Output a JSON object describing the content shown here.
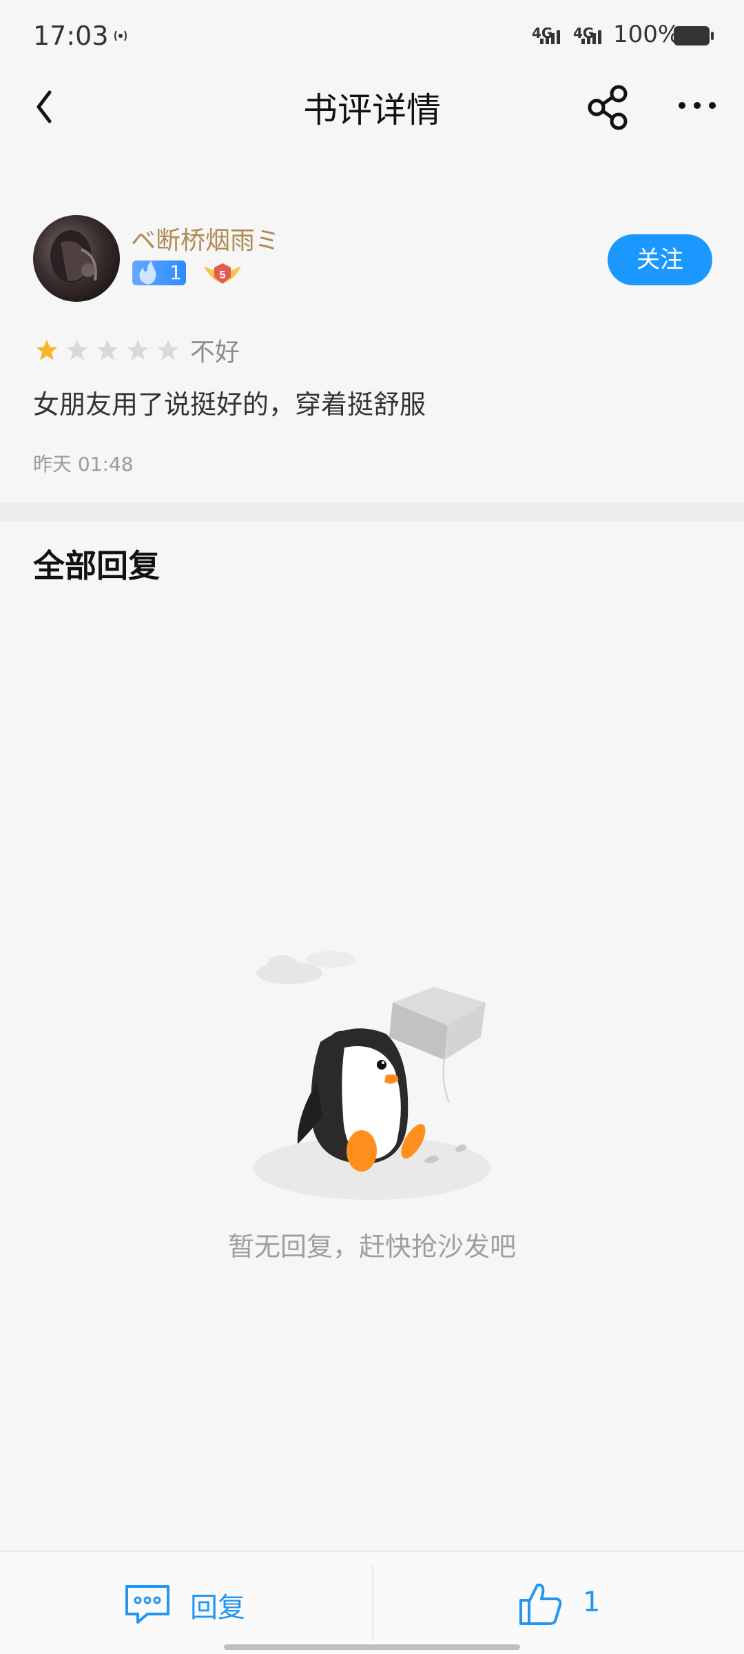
{
  "status_bar": {
    "time": "17:03",
    "network1": "4G",
    "network2": "4G",
    "battery": "100%"
  },
  "header": {
    "title": "书评详情",
    "back_icon": "chevron-left-icon",
    "share_icon": "share-icon",
    "more_icon": "more-dots-icon"
  },
  "review": {
    "username": "ベ断桥烟雨ミ",
    "fire_level": "1",
    "medal_level": "5",
    "follow_label": "关注",
    "rating": 1,
    "rating_max": 5,
    "rating_text": "不好",
    "content": "女朋友用了说挺好的，穿着挺舒服",
    "time": "昨天 01:48"
  },
  "replies": {
    "title": "全部回复",
    "empty_text": "暂无回复，赶快抢沙发吧"
  },
  "bottom_bar": {
    "reply_label": "回复",
    "like_count": "1"
  },
  "colors": {
    "accent": "#1a98ff",
    "username": "#b08a52",
    "star_active": "#f7b52c",
    "star_inactive": "#d9d9d9"
  }
}
